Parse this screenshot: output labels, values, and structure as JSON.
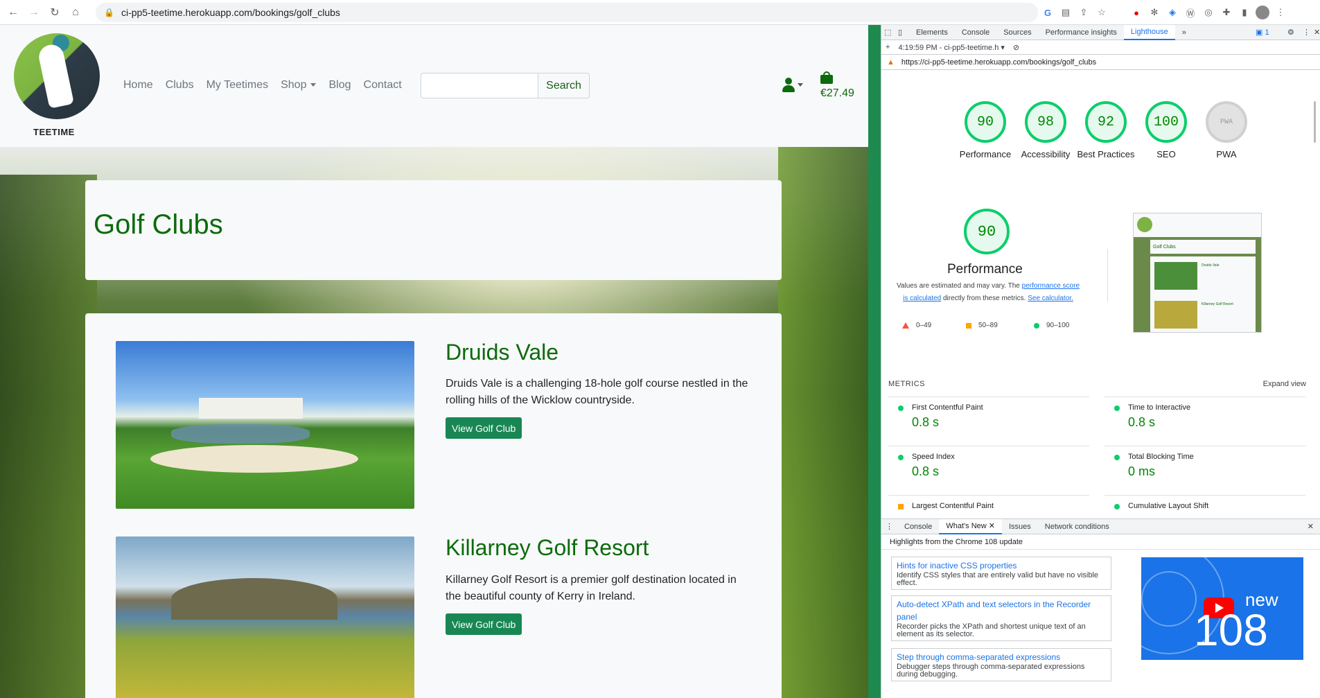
{
  "browser": {
    "url": "ci-pp5-teetime.herokuapp.com/bookings/golf_clubs"
  },
  "site": {
    "logo_text": "TEETIME",
    "nav": [
      "Home",
      "Clubs",
      "My Teetimes",
      "Shop",
      "Blog",
      "Contact"
    ],
    "search_button": "Search",
    "search_placeholder": "",
    "cart_total": "€27.49",
    "page_title": "Golf Clubs",
    "clubs": [
      {
        "name": "Druids Vale",
        "description": "Druids Vale is a challenging 18-hole golf course nestled in the rolling hills of the Wicklow countryside.",
        "button": "View Golf Club"
      },
      {
        "name": "Killarney Golf Resort",
        "description": "Killarney Golf Resort is a premier golf destination located in the beautiful county of Kerry in Ireland.",
        "button": "View Golf Club"
      }
    ]
  },
  "devtools": {
    "tabs": [
      "Elements",
      "Console",
      "Sources",
      "Performance insights",
      "Lighthouse"
    ],
    "active_tab": "Lighthouse",
    "issues_count": "1",
    "report_time": "4:19:59 PM - ci-pp5-teetime.h",
    "report_url": "https://ci-pp5-teetime.herokuapp.com/bookings/golf_clubs",
    "scores": [
      {
        "label": "Performance",
        "value": "90"
      },
      {
        "label": "Accessibility",
        "value": "98"
      },
      {
        "label": "Best Practices",
        "value": "92"
      },
      {
        "label": "SEO",
        "value": "100"
      },
      {
        "label": "PWA",
        "value": "PWA"
      }
    ],
    "performance": {
      "score": "90",
      "title": "Performance",
      "note_prefix": "Values are estimated and may vary. The ",
      "note_link1": "performance score is calculated",
      "note_middle": " directly from these metrics. ",
      "note_link2": "See calculator.",
      "legend": [
        "0–49",
        "50–89",
        "90–100"
      ]
    },
    "thumbnail": {
      "title": "Golf Clubs",
      "club1": "Druids Vale",
      "club2": "Killarney Golf Resort"
    },
    "metrics_heading": "METRICS",
    "expand_view": "Expand view",
    "metrics": [
      {
        "name": "First Contentful Paint",
        "value": "0.8 s"
      },
      {
        "name": "Time to Interactive",
        "value": "0.8 s"
      },
      {
        "name": "Speed Index",
        "value": "0.8 s"
      },
      {
        "name": "Total Blocking Time",
        "value": "0 ms"
      },
      {
        "name": "Largest Contentful Paint",
        "value": ""
      },
      {
        "name": "Cumulative Layout Shift",
        "value": ""
      }
    ],
    "drawer": {
      "tabs": [
        "Console",
        "What's New",
        "Issues",
        "Network conditions"
      ],
      "highlights": "Highlights from the Chrome 108 update",
      "features": [
        {
          "title": "Hints for inactive CSS properties",
          "desc": "Identify CSS styles that are entirely valid but have no visible effect."
        },
        {
          "title": "Auto-detect XPath and text selectors in the Recorder panel",
          "desc": "Recorder picks the XPath and shortest unique text of an element as its selector."
        },
        {
          "title": "Step through comma-separated expressions",
          "desc": "Debugger steps through comma-separated expressions during debugging."
        }
      ],
      "banner_new": "new",
      "banner_version": "108"
    }
  }
}
